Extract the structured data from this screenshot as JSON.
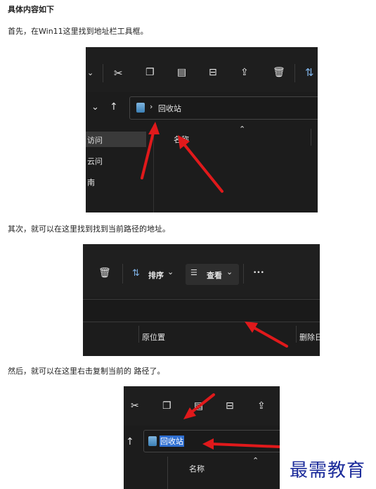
{
  "article": {
    "heading": "具体内容如下",
    "step1": "首先，在Win11这里找到地址栏工具框。",
    "step2": "其次，就可以在这里找到找到当前路径的地址。",
    "step3": "然后，就可以在这里右击复制当前的 路径了。"
  },
  "shot1": {
    "breadcrumb_sep": "›",
    "location": "回收站",
    "column_name": "名称",
    "sidebar_items": [
      "访问",
      "云问",
      "南"
    ]
  },
  "shot2": {
    "sort_label": "排序",
    "view_label": "查看",
    "more_label": "•••",
    "col_original_location": "原位置",
    "col_deleted": "删除日"
  },
  "shot3": {
    "location": "回收站",
    "column_name": "名称"
  },
  "watermark": "最需教育",
  "colors": {
    "arrow": "#e0191b",
    "selection": "#2f6fd1",
    "watermark": "#1a2a9a"
  }
}
